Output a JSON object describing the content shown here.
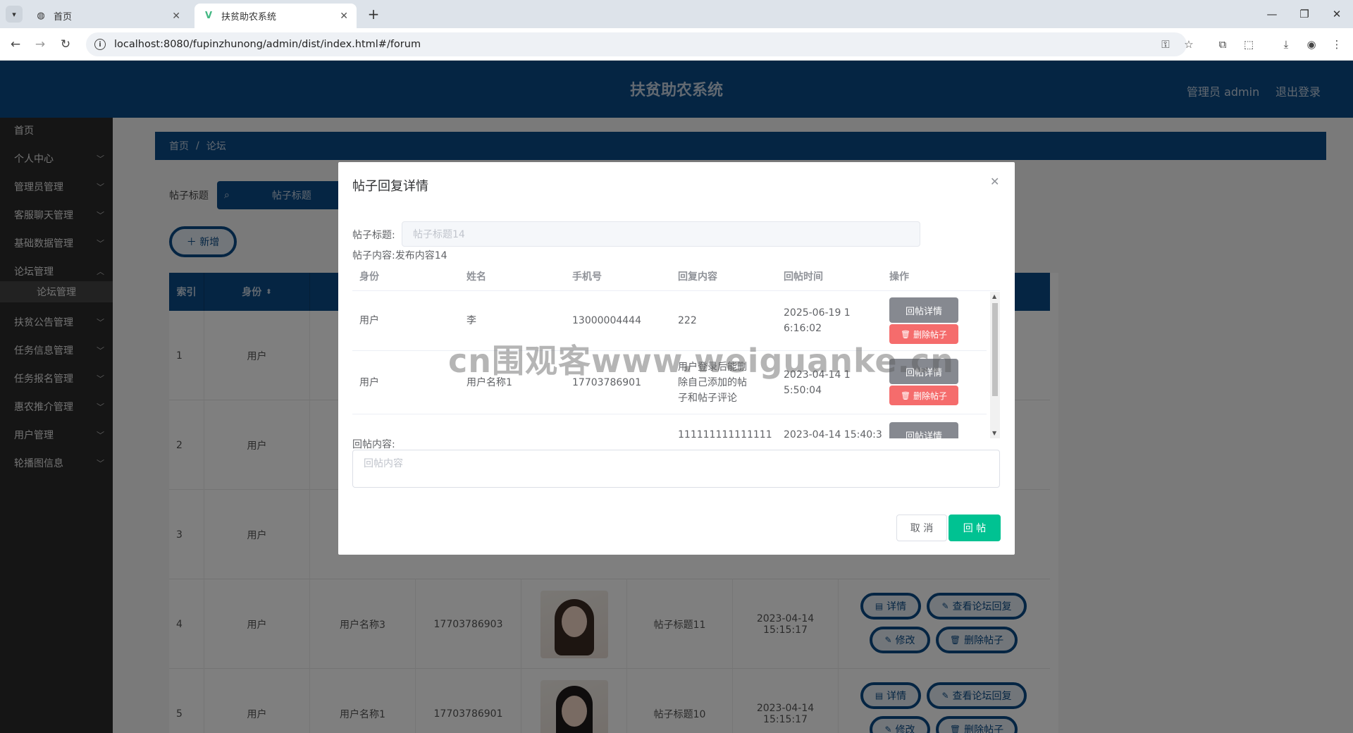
{
  "browser": {
    "tabs": [
      {
        "title": "首页",
        "icon": "globe-icon"
      },
      {
        "title": "扶贫助农系统",
        "icon": "vue-logo-icon"
      }
    ],
    "url": "localhost:8080/fupinzhunong/admin/dist/index.html#/forum"
  },
  "header": {
    "title": "扶贫助农系统",
    "user": "管理员 admin",
    "logout": "退出登录"
  },
  "sidebar": {
    "items": [
      {
        "label": "首页",
        "expandable": false
      },
      {
        "label": "个人中心",
        "expandable": true
      },
      {
        "label": "管理员管理",
        "expandable": true
      },
      {
        "label": "客服聊天管理",
        "expandable": true
      },
      {
        "label": "基础数据管理",
        "expandable": true
      },
      {
        "label": "论坛管理",
        "expandable": true,
        "expanded": true
      },
      {
        "label": "扶贫公告管理",
        "expandable": true
      },
      {
        "label": "任务信息管理",
        "expandable": true
      },
      {
        "label": "任务报名管理",
        "expandable": true
      },
      {
        "label": "惠农推介管理",
        "expandable": true
      },
      {
        "label": "用户管理",
        "expandable": true
      },
      {
        "label": "轮播图信息",
        "expandable": true
      }
    ],
    "subitem": "论坛管理"
  },
  "main": {
    "breadcrumb": [
      "首页",
      "论坛"
    ],
    "search_label": "帖子标题",
    "search_placeholder": "帖子标题",
    "add_button": "＋ 新增",
    "columns": [
      "索引",
      "身份"
    ],
    "rows": [
      {
        "index": "1",
        "identity": "用户"
      },
      {
        "index": "2",
        "identity": "用户"
      },
      {
        "index": "3",
        "identity": "用户"
      },
      {
        "index": "4",
        "identity": "用户",
        "name": "用户名称3",
        "phone": "17703786903",
        "title": "帖子标题11",
        "time": "2023-04-14 15:15:17"
      },
      {
        "index": "5",
        "identity": "用户",
        "name": "用户名称1",
        "phone": "17703786901",
        "title": "帖子标题10",
        "time": "2023-04-14 15:15:17"
      }
    ],
    "ops": {
      "detail": "详情",
      "view_reply": "查看论坛回复",
      "edit": "修改",
      "delete": "删除帖子"
    }
  },
  "dialog": {
    "title": "帖子回复详情",
    "title_label": "帖子标题:",
    "title_placeholder": "帖子标题14",
    "content_label": "帖子内容:",
    "content_value": "发布内容14",
    "columns": [
      "身份",
      "姓名",
      "手机号",
      "回复内容",
      "回帖时间",
      "操作"
    ],
    "rows": [
      {
        "identity": "用户",
        "name": "李",
        "phone": "13000004444",
        "reply": "222",
        "time": "2025-06-19 16:16:02"
      },
      {
        "identity": "用户",
        "name": "用户名称1",
        "phone": "17703786901",
        "reply": "用户登录后能删除自己添加的帖子和帖子评论",
        "time": "2023-04-14 15:50:04"
      },
      {
        "identity": "",
        "name": "",
        "phone": "",
        "reply": "111111111111111",
        "time": "2023-04-14 15:40:3"
      }
    ],
    "row_detail": "回帖详情",
    "row_delete": "删除帖子",
    "reply_label": "回帖内容:",
    "reply_placeholder": "回帖内容",
    "cancel": "取 消",
    "submit": "回 帖"
  },
  "watermark": "cn围观客www.weiguanke.cn"
}
